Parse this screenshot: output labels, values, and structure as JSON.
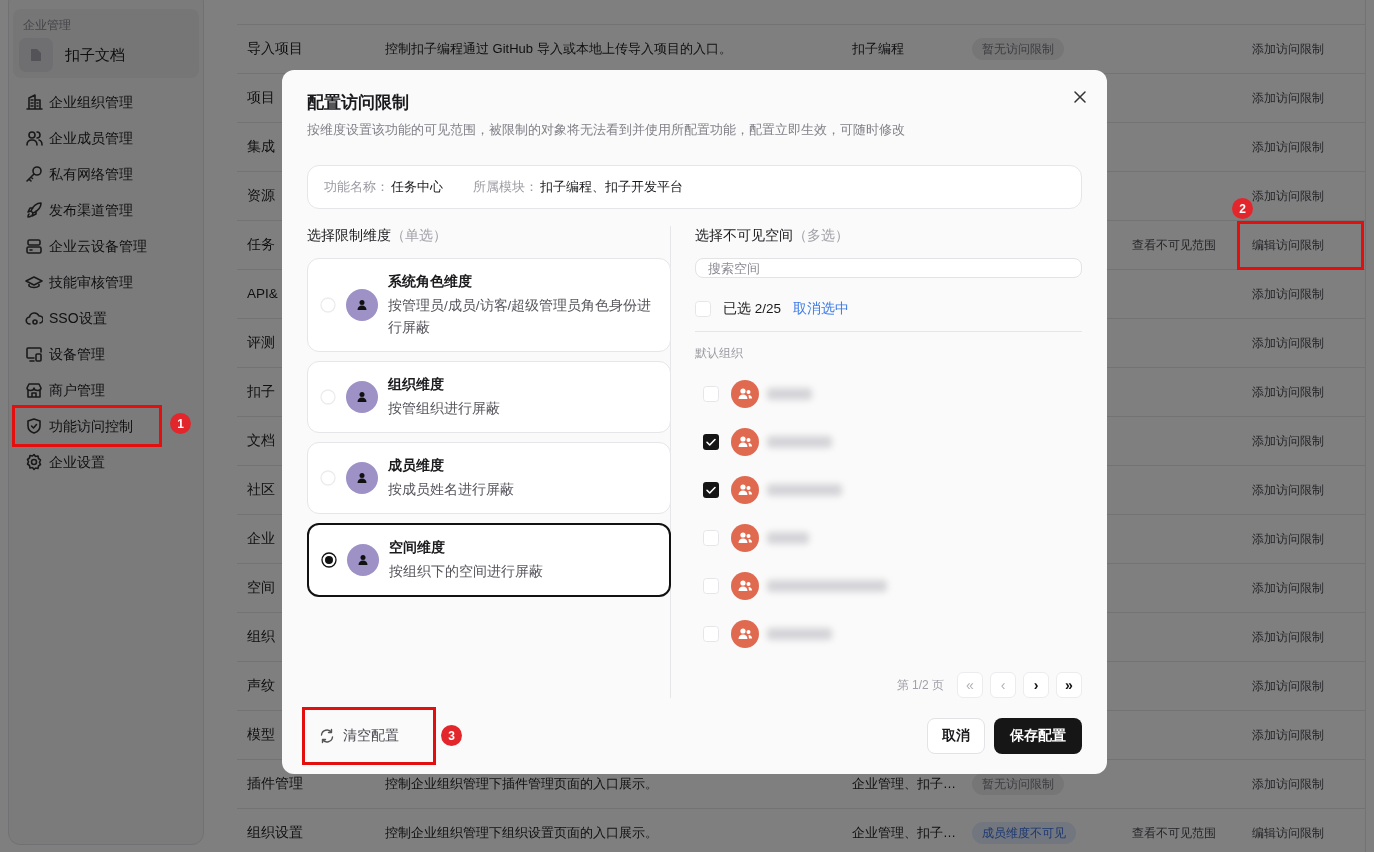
{
  "sidebar": {
    "section_label": "企业管理",
    "workspace": "扣子文档",
    "items": [
      {
        "label": "企业组织管理"
      },
      {
        "label": "企业成员管理"
      },
      {
        "label": "私有网络管理"
      },
      {
        "label": "发布渠道管理"
      },
      {
        "label": "企业云设备管理"
      },
      {
        "label": "技能审核管理"
      },
      {
        "label": "SSO设置"
      },
      {
        "label": "设备管理"
      },
      {
        "label": "商户管理"
      },
      {
        "label": "功能访问控制",
        "callout": "1"
      },
      {
        "label": "企业设置"
      }
    ]
  },
  "table": {
    "rows": [
      {},
      {
        "name": "导入项目",
        "description": "控制扣子编程通过 GitHub 导入或本地上传导入项目的入口。",
        "module": "扣子编程",
        "status": {
          "text": "暂无访问限制",
          "kind": "none"
        },
        "action": "添加访问限制"
      },
      {
        "name": "项目",
        "action": "添加访问限制"
      },
      {
        "name": "集成",
        "action": "添加访问限制"
      },
      {
        "name": "资源",
        "action": "添加访问限制"
      },
      {
        "name": "任务",
        "view_link": "查看不可见范围",
        "action": "编辑访问限制",
        "callout": "2"
      },
      {
        "name": "API&",
        "action": "添加访问限制"
      },
      {
        "name": "评测",
        "action": "添加访问限制"
      },
      {
        "name": "扣子",
        "action": "添加访问限制"
      },
      {
        "name": "文档",
        "action": "添加访问限制"
      },
      {
        "name": "社区",
        "action": "添加访问限制"
      },
      {
        "name": "企业",
        "action": "添加访问限制"
      },
      {
        "name": "空间",
        "action": "添加访问限制"
      },
      {
        "name": "组织",
        "action": "添加访问限制"
      },
      {
        "name": "声纹",
        "action": "添加访问限制"
      },
      {
        "name": "模型",
        "action": "添加访问限制"
      },
      {
        "name": "插件管理",
        "description": "控制企业组织管理下插件管理页面的入口展示。",
        "module": "企业管理、扣子…",
        "status": {
          "text": "暂无访问限制",
          "kind": "none"
        },
        "action": "添加访问限制"
      },
      {
        "name": "组织设置",
        "description": "控制企业组织管理下组织设置页面的入口展示。",
        "module": "企业管理、扣子…",
        "status": {
          "text": "成员维度不可见",
          "kind": "member"
        },
        "view_link": "查看不可见范围",
        "action": "编辑访问限制"
      }
    ]
  },
  "dialog": {
    "title": "配置访问限制",
    "subtitle": "按维度设置该功能的可见范围，被限制的对象将无法看到并使用所配置功能，配置立即生效，可随时修改",
    "info": [
      {
        "label": "功能名称：",
        "value": "任务中心"
      },
      {
        "label": "所属模块：",
        "value": "扣子编程、扣子开发平台"
      }
    ],
    "dimensions": {
      "heading": "选择限制维度",
      "hint": "（单选）",
      "options": [
        {
          "title": "系统角色维度",
          "description": "按管理员/成员/访客/超级管理员角色身份进行屏蔽",
          "selected": false
        },
        {
          "title": "组织维度",
          "description": "按管组织进行屏蔽",
          "selected": false
        },
        {
          "title": "成员维度",
          "description": "按成员姓名进行屏蔽",
          "selected": false
        },
        {
          "title": "空间维度",
          "description": "按组织下的空间进行屏蔽",
          "selected": true
        }
      ]
    },
    "spaces": {
      "heading": "选择不可见空间",
      "hint": "（多选）",
      "search": {
        "placeholder": "搜索空间"
      },
      "select_all": {
        "checked": false,
        "count": "已选 2/25",
        "clear_link": "取消选中"
      },
      "group": "默认组织",
      "items": [
        {
          "checked": false
        },
        {
          "checked": true
        },
        {
          "checked": true
        },
        {
          "checked": false
        },
        {
          "checked": false
        },
        {
          "checked": false
        }
      ],
      "pagination": {
        "text": "第 1/2 页",
        "buttons": [
          {
            "symbol": "«",
            "disabled": true
          },
          {
            "symbol": "‹",
            "disabled": true
          },
          {
            "symbol": "›",
            "disabled": false
          },
          {
            "symbol": "»",
            "disabled": false
          }
        ]
      }
    },
    "footer": {
      "reset": {
        "label": "清空配置",
        "callout": "3"
      },
      "cancel": "取消",
      "save": "保存配置"
    }
  }
}
